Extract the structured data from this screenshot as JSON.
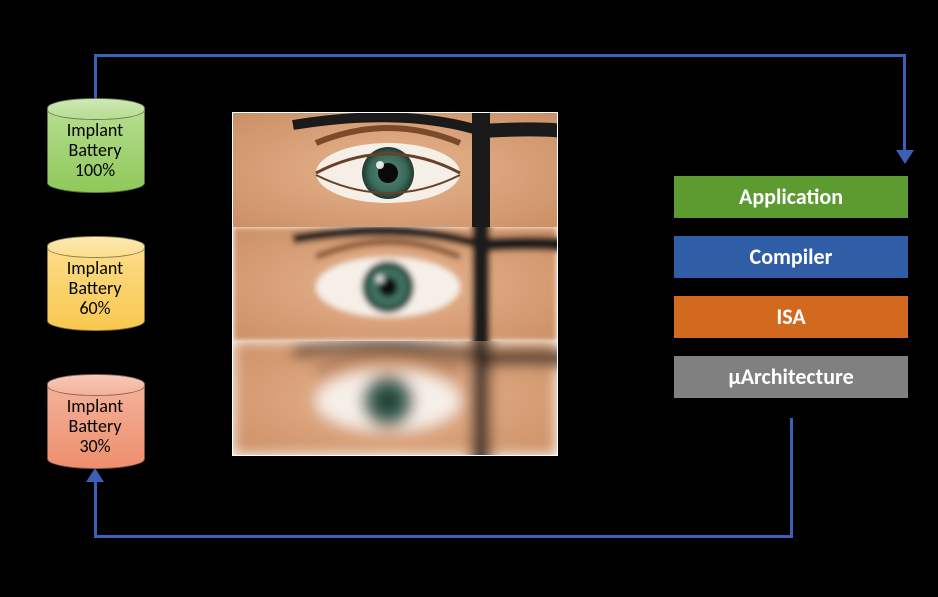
{
  "batteries": [
    {
      "line1": "Implant",
      "line2": "Battery",
      "line3": "100%"
    },
    {
      "line1": "Implant",
      "line2": "Battery",
      "line3": "60%"
    },
    {
      "line1": "Implant",
      "line2": "Battery",
      "line3": "30%"
    }
  ],
  "stack": {
    "app": "Application",
    "compiler": "Compiler",
    "isa": "ISA",
    "uarch": "µArchitecture"
  },
  "colors": {
    "arrow": "#3c5fb8",
    "battery_green": "#8fc95a",
    "battery_yellow": "#f8c850",
    "battery_red": "#ed8f6e",
    "bar_app": "#5b9b2f",
    "bar_compiler": "#2f5ea7",
    "bar_isa": "#d2691e",
    "bar_uarch": "#808080"
  },
  "eye_images": {
    "description": "three stacked close-up photos of a human eye behind eyeglasses, progressively more blurred from top (sharp) to bottom (very blurry), corresponding to 100%, 60%, 30% battery"
  }
}
